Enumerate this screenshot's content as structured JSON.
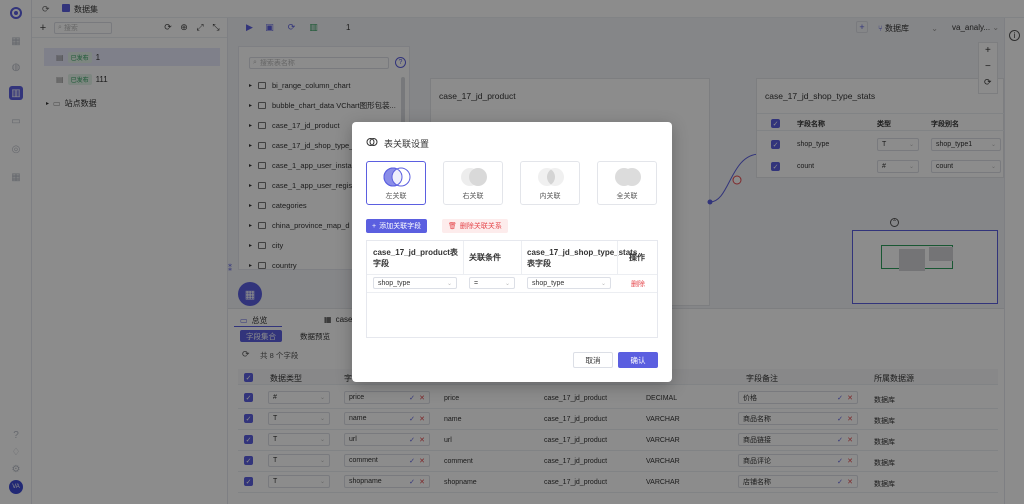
{
  "app": {
    "avatar": "VA"
  },
  "topbar": {
    "dataset_label": "数据集"
  },
  "tree": {
    "search_placeholder": "搜索",
    "nodes": [
      {
        "badge": "已发布",
        "name": "1"
      },
      {
        "badge": "已发布",
        "name": "111"
      },
      {
        "name": "站点数据"
      }
    ]
  },
  "canvas": {
    "zoom_text": "1",
    "datasource_label": "数据库",
    "schema_label": "va_analy...",
    "table_search_placeholder": "搜索表名称",
    "tables": [
      "bi_range_column_chart",
      "bubble_chart_data  VChart图形包装...",
      "case_17_jd_product",
      "case_17_jd_shop_type_",
      "case_1_app_user_instal",
      "case_1_app_user_regist",
      "categories",
      "china_province_map_d",
      "city",
      "country"
    ],
    "card_left_title": "case_17_jd_product",
    "card_right_title": "case_17_jd_shop_type_stats",
    "right_card_headers": [
      "字段名称",
      "类型",
      "字段别名"
    ],
    "right_card_rows": [
      {
        "name": "shop_type",
        "type": "T",
        "alias": "shop_type1"
      },
      {
        "name": "count",
        "type": "#",
        "alias": "count"
      }
    ]
  },
  "bottom": {
    "tab_overview": "总览",
    "tab_case": "case",
    "pill_fields": "字段集合",
    "pill_preview": "数据预览",
    "field_count": "共 8 个字段",
    "headers": [
      "数据类型",
      "字",
      "",
      "",
      "字段备注",
      "所属数据源"
    ],
    "rows": [
      {
        "type": "#",
        "name": "price",
        "orig": "price",
        "table": "case_17_jd_product",
        "dtype": "DECIMAL",
        "remark": "价格",
        "source": "数据库"
      },
      {
        "type": "T",
        "name": "name",
        "orig": "name",
        "table": "case_17_jd_product",
        "dtype": "VARCHAR",
        "remark": "商品名称",
        "source": "数据库"
      },
      {
        "type": "T",
        "name": "url",
        "orig": "url",
        "table": "case_17_jd_product",
        "dtype": "VARCHAR",
        "remark": "商品链接",
        "source": "数据库"
      },
      {
        "type": "T",
        "name": "comment",
        "orig": "comment",
        "table": "case_17_jd_product",
        "dtype": "VARCHAR",
        "remark": "商品评论",
        "source": "数据库"
      },
      {
        "type": "T",
        "name": "shopname",
        "orig": "shopname",
        "table": "case_17_jd_product",
        "dtype": "VARCHAR",
        "remark": "店铺名称",
        "source": "数据库"
      }
    ]
  },
  "modal": {
    "title": "表关联设置",
    "join_options": [
      "左关联",
      "右关联",
      "内关联",
      "全关联"
    ],
    "add_field_button": "添加关联字段",
    "delete_relation_button": "删除关联关系",
    "col_left": "case_17_jd_product表字段",
    "col_condition": "关联条件",
    "col_right": "case_17_jd_shop_type_stats表字段",
    "col_action": "操作",
    "row": {
      "left_field": "shop_type",
      "condition": "=",
      "right_field": "shop_type",
      "action": "删除"
    },
    "cancel": "取消",
    "confirm": "确认"
  },
  "colors": {
    "accent": "#5b5fe0",
    "danger": "#e5484d",
    "success": "#2f9e5d"
  }
}
